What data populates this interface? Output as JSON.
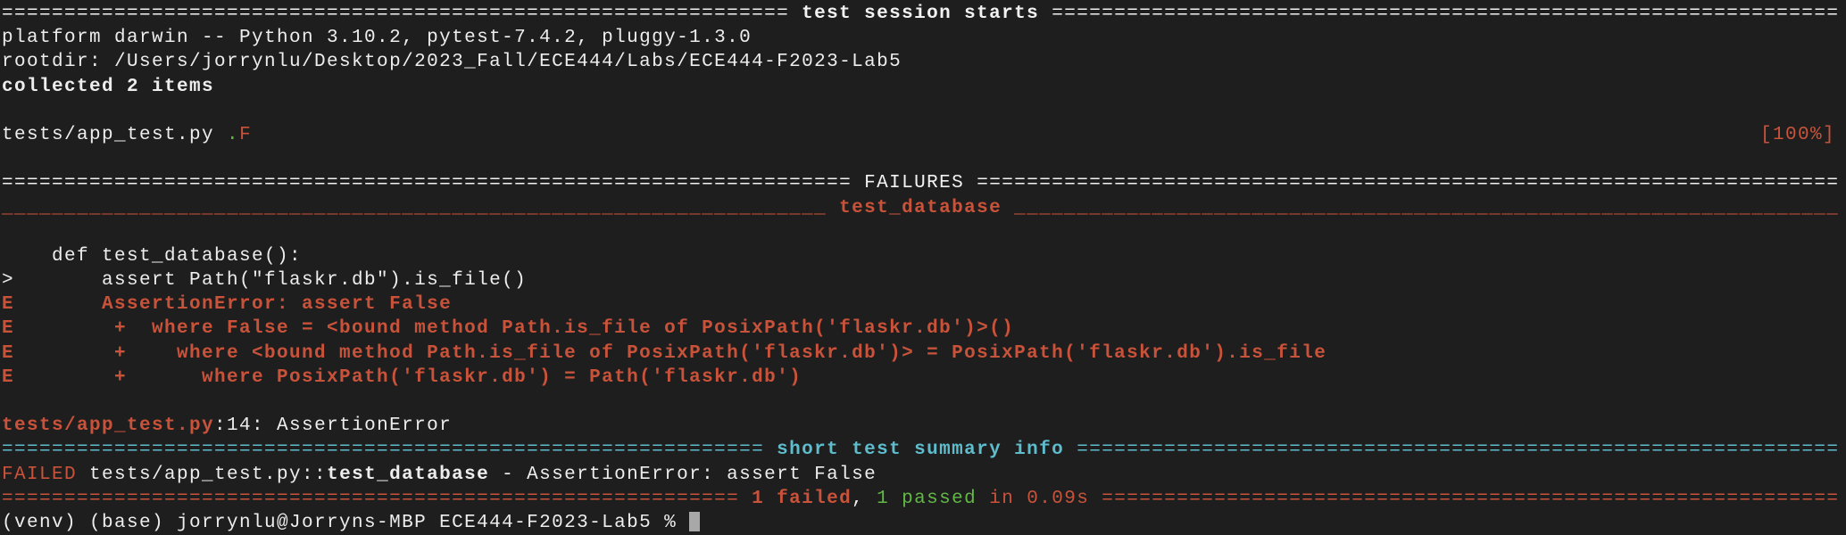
{
  "colors": {
    "background": "#1e1e1e",
    "error": "#c9533a",
    "pass": "#62b845",
    "summary": "#5fbccc",
    "text": "#ededed"
  },
  "session": {
    "header_title": "test session starts",
    "platform": "platform darwin -- Python 3.10.2, pytest-7.4.2, pluggy-1.3.0",
    "rootdir": "rootdir: /Users/jorrynlu/Desktop/2023_Fall/ECE444/Labs/ECE444-F2023-Lab5",
    "collected": "collected 2 items",
    "test_file": "tests/app_test.py ",
    "result_pass": ".",
    "result_fail": "F",
    "progress": "[100%]"
  },
  "failures": {
    "header_title": "FAILURES",
    "test_title": "test_database",
    "code_lines": [
      "    def test_database():",
      ">       assert Path(\"flaskr.db\").is_file()"
    ],
    "error_lines": [
      "E       AssertionError: assert False",
      "E        +  where False = <bound method Path.is_file of PosixPath('flaskr.db')>()",
      "E        +    where <bound method Path.is_file of PosixPath('flaskr.db')> = PosixPath('flaskr.db').is_file",
      "E        +      where PosixPath('flaskr.db') = Path('flaskr.db')"
    ],
    "location_file": "tests/app_test.py",
    "location_rest": ":14: AssertionError"
  },
  "summary": {
    "header_title": "short test summary info",
    "failed_label": "FAILED",
    "failed_path": " tests/app_test.py::",
    "failed_test": "test_database",
    "failed_msg": " - AssertionError: assert False",
    "failed_count": "1 failed",
    "sep": ", ",
    "passed_count": "1 passed",
    "duration": " in 0.09s"
  },
  "prompt": {
    "text": "(venv) (base) jorrynlu@Jorryns-MBP ECE444-F2023-Lab5 % "
  }
}
